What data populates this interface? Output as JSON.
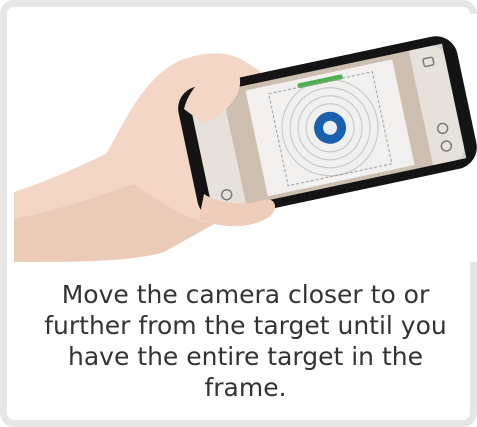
{
  "instruction_text": "Move the camera closer to or further from the target until you have the entire target in the frame.",
  "phone_screen": {
    "target_center_symbol": "⬢",
    "palette": {
      "skin": "#f3d6c6",
      "skin_shadow": "#e2b8a3",
      "phone_body": "#141414",
      "screen_bg": "#cdbfb0",
      "target_ring": "#d8d8d8",
      "target_bull": "#1b5fb0",
      "accent_bar": "#4caf50"
    }
  }
}
